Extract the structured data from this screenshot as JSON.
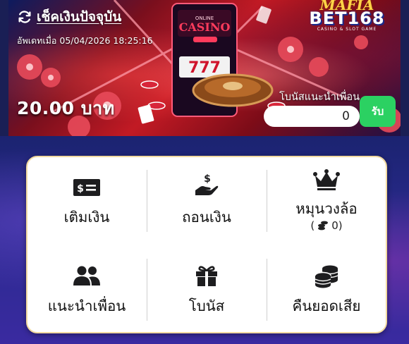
{
  "header": {
    "check_balance_title": "เช็คเงินปัจจุบัน",
    "updated_at": "อัพเดทเมื่อ 05/04/2026 18:25:16",
    "balance": "20.00 บาท",
    "brand_top": "MAFIA",
    "brand_main": "BET168",
    "brand_sub": "CASINO & SLOT GAME",
    "referral_label": "โบนัสแนะนำเพื่อน",
    "referral_value": "0",
    "claim_label": "รับ"
  },
  "menu": {
    "deposit": {
      "label": "เติมเงิน",
      "icon": "money-bill-icon"
    },
    "withdraw": {
      "label": "ถอนเงิน",
      "icon": "hand-dollar-icon"
    },
    "wheel": {
      "label": "หมุนวงล้อ",
      "coins_open": "(",
      "coins": "0)",
      "icon": "crown-icon"
    },
    "refer": {
      "label": "แนะนำเพื่อน",
      "icon": "users-icon"
    },
    "bonus": {
      "label": "โบนัส",
      "icon": "gift-icon"
    },
    "cashback": {
      "label": "คืนยอดเสีย",
      "icon": "coins-icon"
    }
  },
  "colors": {
    "claim_button": "#2bd162",
    "card_border": "#f1d9a0",
    "page_bg": "#1a1f55"
  }
}
